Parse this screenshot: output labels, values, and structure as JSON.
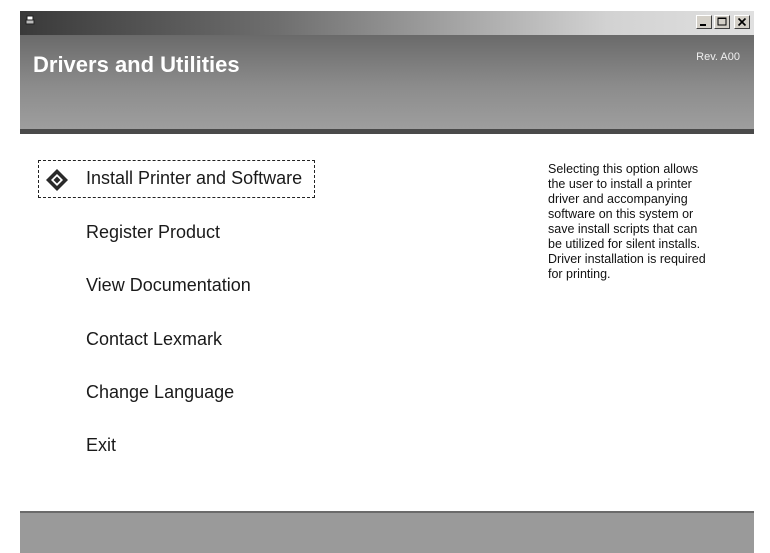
{
  "window": {
    "header_title": "Drivers and Utilities",
    "revision": "Rev. A00",
    "controls": {
      "minimize_icon": "minimize-icon",
      "maximize_icon": "maximize-icon",
      "close_icon": "close-icon"
    }
  },
  "menu": {
    "selected_icon": "diamond-icon",
    "items": [
      {
        "label": "Install Printer and Software",
        "selected": true
      },
      {
        "label": "Register Product"
      },
      {
        "label": "View Documentation"
      },
      {
        "label": "Contact Lexmark"
      },
      {
        "label": "Change Language"
      },
      {
        "label": "Exit"
      }
    ]
  },
  "description": {
    "lines": [
      "Selecting this option allows",
      "the user to install a printer",
      "driver and accompanying",
      "software on this system or",
      "save install scripts that can",
      "be utilized for silent installs.",
      "Driver installation is required",
      "for printing."
    ]
  },
  "colors": {
    "header_bg": "#8c8c8c",
    "header_border": "#4a4a4a",
    "footer_bg": "#9a9a9a",
    "text": "#1a1a1a"
  }
}
